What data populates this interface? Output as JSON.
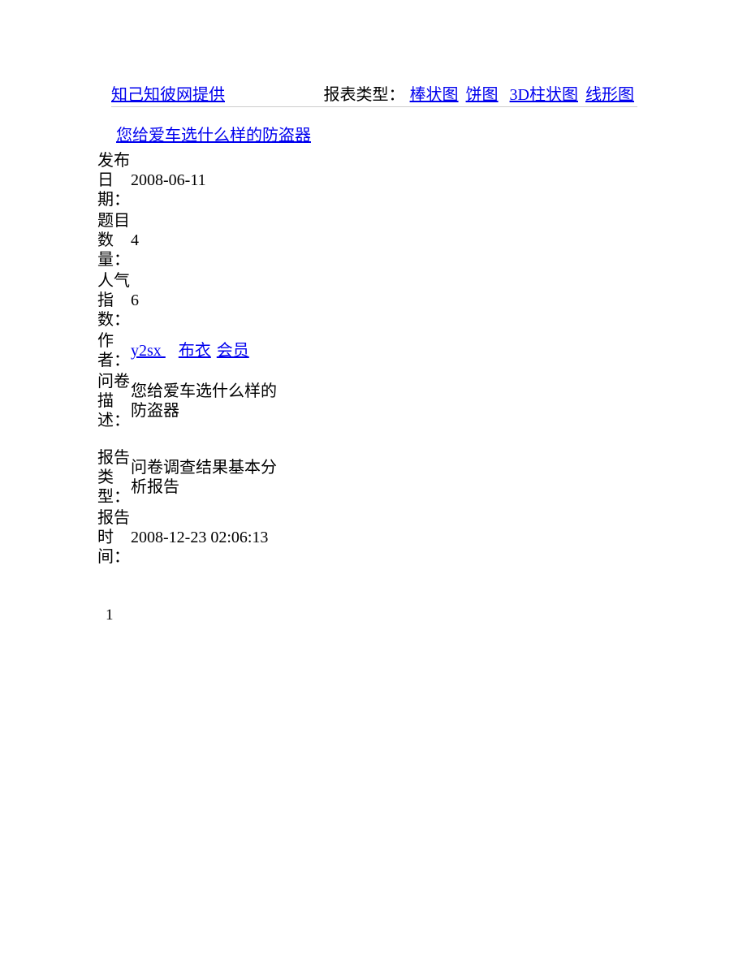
{
  "header": {
    "provider": "知己知彼网提供",
    "report_type_label": "报表类型：",
    "links": {
      "bar": "棒状图",
      "pie": "饼图",
      "bar3d": "3D柱状图",
      "line": "线形图"
    }
  },
  "title": "您给爱车选什么样的防盗器",
  "meta": {
    "publish_date_label": "发布日期：",
    "publish_date": "2008-06-11",
    "q_count_label": "题目数量：",
    "q_count": "4",
    "popularity_label": "人气指数：",
    "popularity": "6",
    "author_label": "作者：",
    "author_user": "y2sx ",
    "author_level1": "布衣",
    "author_level2": "会员",
    "desc_label": "问卷描述：",
    "desc": "您给爱车选什么样的防盗器",
    "report_type2_label": "报告类型：",
    "report_type2": "问卷调查结果基本分析报告",
    "report_time_label": "报告时间：",
    "report_time": "2008-12-23 02:06:13"
  },
  "page_number": "1"
}
